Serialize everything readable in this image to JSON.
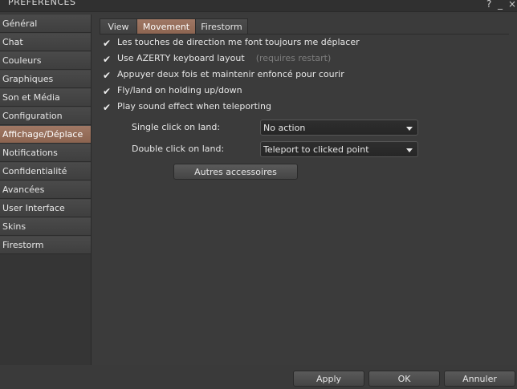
{
  "window": {
    "title": "PRÉFÉRENCES",
    "help_label": "?",
    "minimize_label": "_",
    "close_label": "×"
  },
  "sidebar": {
    "items": [
      {
        "label": "Général"
      },
      {
        "label": "Chat"
      },
      {
        "label": "Couleurs"
      },
      {
        "label": "Graphiques"
      },
      {
        "label": "Son et Média"
      },
      {
        "label": "Configuration"
      },
      {
        "label": "Affichage/Déplace",
        "active": true
      },
      {
        "label": "Notifications"
      },
      {
        "label": "Confidentialité"
      },
      {
        "label": "Avancées"
      },
      {
        "label": "User Interface"
      },
      {
        "label": "Skins"
      },
      {
        "label": "Firestorm"
      }
    ]
  },
  "tabs": [
    {
      "label": "View"
    },
    {
      "label": "Movement",
      "active": true
    },
    {
      "label": "Firestorm"
    }
  ],
  "checkboxes": [
    {
      "label": "Les touches de direction me font toujours me déplacer",
      "checked": true
    },
    {
      "label": "Use AZERTY keyboard layout",
      "checked": true,
      "hint": "(requires restart)"
    },
    {
      "label": "Appuyer deux fois et maintenir enfoncé pour courir",
      "checked": true
    },
    {
      "label": "Fly/land on holding up/down",
      "checked": true
    },
    {
      "label": "Play sound effect when teleporting",
      "checked": true
    }
  ],
  "single_click": {
    "label": "Single click on land:",
    "value": "No action"
  },
  "double_click": {
    "label": "Double click on land:",
    "value": "Teleport to clicked point"
  },
  "other_attachments_button": "Autres accessoires",
  "footer": {
    "apply": "Apply",
    "ok": "OK",
    "cancel": "Annuler"
  },
  "colors": {
    "accent": "#8c6450",
    "panel_bg": "#3b3b3b"
  }
}
